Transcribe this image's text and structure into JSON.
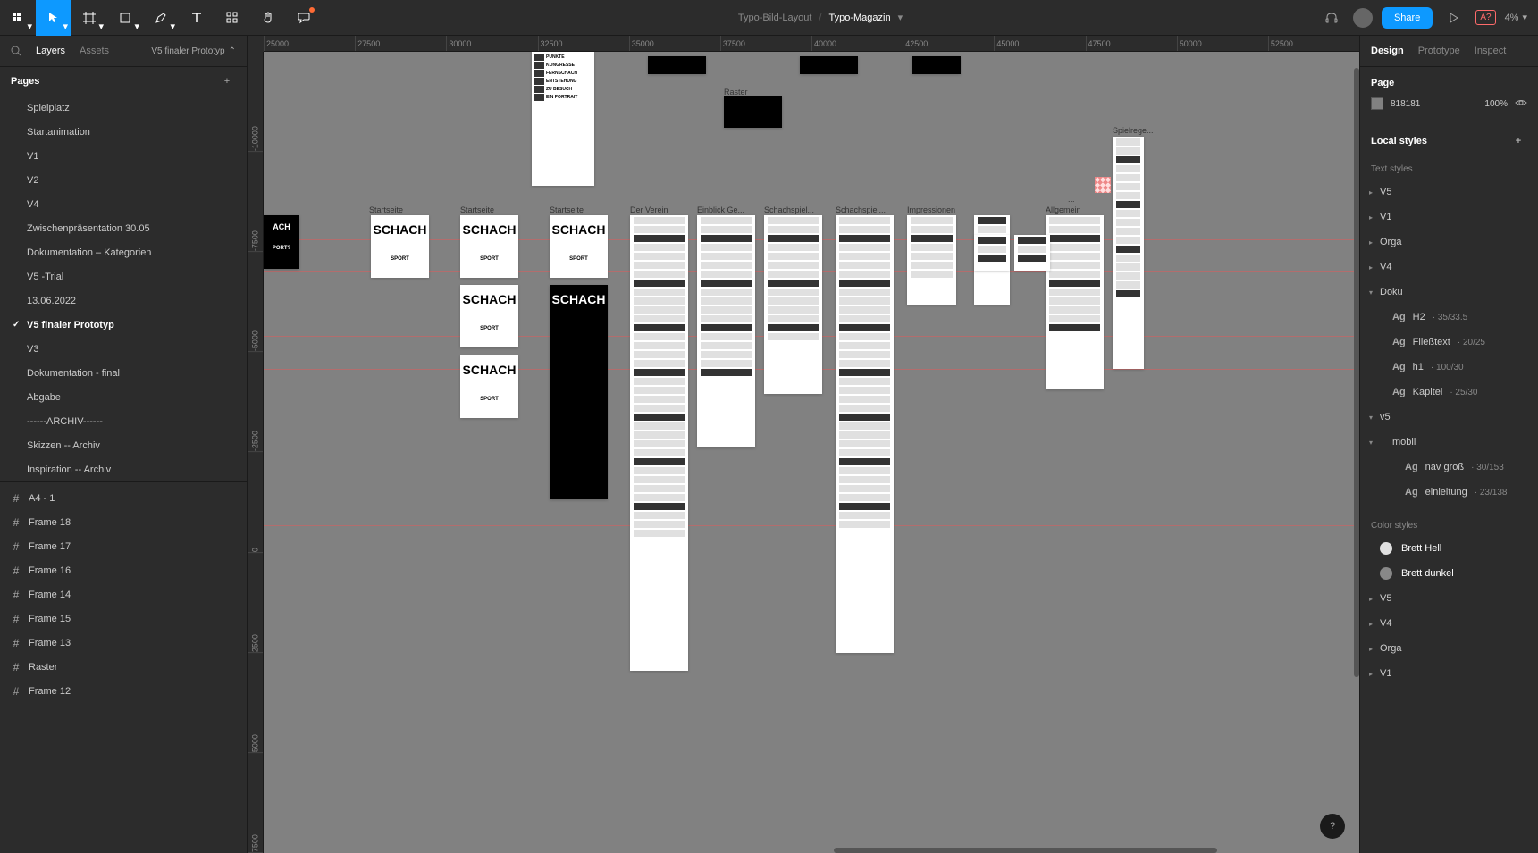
{
  "breadcrumb": {
    "project": "Typo-Bild-Layout",
    "file": "Typo-Magazin"
  },
  "share_label": "Share",
  "zoom": "4%",
  "left_panel": {
    "tabs": {
      "layers": "Layers",
      "assets": "Assets"
    },
    "current_page": "V5 finaler Prototyp",
    "pages_title": "Pages",
    "pages": [
      "Spielplatz",
      "Startanimation",
      "V1",
      "V2",
      "V4",
      "Zwischenpräsentation 30.05",
      "Dokumentation – Kategorien",
      "V5 -Trial",
      "13.06.2022",
      "V5 finaler Prototyp",
      "V3",
      "Dokumentation - final",
      "Abgabe",
      "------ARCHIV------",
      "Skizzen -- Archiv",
      "Inspiration -- Archiv"
    ],
    "active_page_index": 9,
    "layers": [
      "A4 - 1",
      "Frame 18",
      "Frame 17",
      "Frame 16",
      "Frame 14",
      "Frame 15",
      "Frame 13",
      "Raster",
      "Frame 12"
    ]
  },
  "ruler": {
    "h": [
      "25000",
      "27500",
      "30000",
      "32500",
      "35000",
      "37500",
      "40000",
      "42500",
      "45000",
      "47500",
      "50000",
      "52500"
    ],
    "v": [
      "-10000",
      "-7500",
      "-5000",
      "-2500",
      "0",
      "2500",
      "5000",
      "7500"
    ]
  },
  "canvas_frames": {
    "labels": [
      "Startseite",
      "Startseite",
      "Startseite",
      "Der Verein",
      "Einblick Ge...",
      "Schachspiel...",
      "Schachspiel...",
      "Impressionen",
      "Allgemein",
      "Spielrege...",
      "..."
    ],
    "keywords": [
      "PUNKTE",
      "KONGRESSE",
      "FERNSCHACH",
      "ENTSTEHUNG",
      "ZU BESUCH",
      "EIN PORTRAIT"
    ],
    "schach": "SCHACH",
    "sport": "SPORT",
    "sport_q": "PORT?",
    "raster": "Raster"
  },
  "right_panel": {
    "tabs": {
      "design": "Design",
      "prototype": "Prototype",
      "inspect": "Inspect"
    },
    "page_title": "Page",
    "page_color": "818181",
    "page_opacity": "100%",
    "local_styles_title": "Local styles",
    "text_styles_title": "Text styles",
    "text_groups": [
      "V5",
      "V1",
      "Orga",
      "V4"
    ],
    "doku_label": "Doku",
    "doku_styles": [
      {
        "name": "H2",
        "meta": "35/33.5"
      },
      {
        "name": "Fließtext",
        "meta": "20/25"
      },
      {
        "name": "h1",
        "meta": "100/30"
      },
      {
        "name": "Kapitel",
        "meta": "25/30"
      }
    ],
    "v5_label": "v5",
    "mobil_label": "mobil",
    "mobil_styles": [
      {
        "name": "nav groß",
        "meta": "30/153"
      },
      {
        "name": "einleitung",
        "meta": "23/138"
      }
    ],
    "color_styles_title": "Color styles",
    "color_styles": [
      {
        "name": "Brett Hell",
        "color": "#e0e0e0"
      },
      {
        "name": "Brett dunkel",
        "color": "#888888"
      }
    ],
    "color_groups": [
      "V5",
      "V4",
      "Orga",
      "V1"
    ]
  }
}
